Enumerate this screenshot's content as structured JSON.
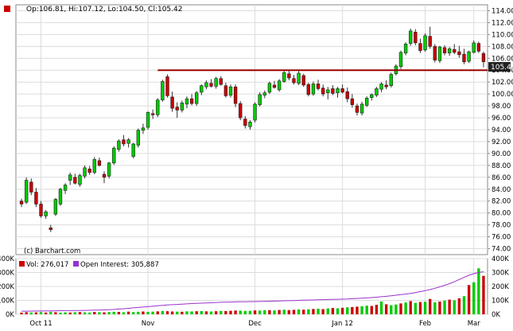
{
  "chart_data": [
    {
      "type": "candlestick",
      "legend": {
        "label": "Op:106.81, Hi:107.12, Lo:104.50, Cl:105.42"
      },
      "open": 106.81,
      "high": 107.12,
      "low": 104.5,
      "close": 105.42,
      "last_price_label": "105.42",
      "watermark": "(c) Barchart.com",
      "y_ticks": [
        "114.00",
        "112.00",
        "110.00",
        "108.00",
        "106.00",
        "104.00",
        "102.00",
        "100.00",
        "98.00",
        "96.00",
        "94.00",
        "92.00",
        "90.00",
        "88.00",
        "86.00",
        "84.00",
        "82.00",
        "80.00",
        "78.00",
        "76.00",
        "74.00"
      ],
      "ylim": [
        73,
        115
      ],
      "support_line": 104.0,
      "x_tick_labels": [
        "Oct 11",
        "Nov",
        "Dec",
        "Jan 12",
        "Feb",
        "Mar"
      ],
      "grid": true,
      "candles": [
        [
          82.0,
          82.4,
          81.0,
          81.5
        ],
        [
          81.8,
          86.0,
          81.5,
          85.5
        ],
        [
          85.2,
          85.8,
          83.0,
          83.5
        ],
        [
          83.5,
          84.2,
          81.0,
          81.5
        ],
        [
          81.5,
          82.0,
          79.2,
          79.5
        ],
        [
          79.5,
          80.5,
          79.0,
          80.2
        ],
        [
          77.5,
          78.0,
          76.8,
          77.2
        ],
        [
          79.8,
          82.5,
          79.5,
          82.3
        ],
        [
          81.5,
          84.2,
          81.2,
          84.0
        ],
        [
          83.8,
          85.0,
          83.2,
          84.7
        ],
        [
          85.5,
          86.8,
          84.7,
          86.4
        ],
        [
          86.0,
          86.6,
          84.8,
          85.0
        ],
        [
          84.8,
          86.6,
          84.4,
          86.3
        ],
        [
          86.2,
          88.0,
          85.8,
          87.6
        ],
        [
          87.4,
          87.9,
          86.4,
          86.8
        ],
        [
          86.8,
          89.4,
          86.5,
          89.0
        ],
        [
          88.8,
          89.3,
          87.8,
          88.0
        ],
        [
          86.5,
          87.0,
          85.0,
          86.0
        ],
        [
          86.2,
          88.6,
          85.8,
          88.4
        ],
        [
          88.4,
          91.2,
          88.1,
          90.9
        ],
        [
          90.7,
          92.4,
          90.3,
          92.1
        ],
        [
          92.3,
          93.1,
          91.2,
          91.6
        ],
        [
          91.7,
          92.6,
          91.0,
          92.3
        ],
        [
          89.5,
          91.8,
          89.2,
          91.6
        ],
        [
          91.4,
          94.2,
          91.0,
          93.9
        ],
        [
          93.9,
          95.0,
          93.3,
          94.3
        ],
        [
          94.4,
          97.1,
          94.0,
          96.9
        ],
        [
          96.7,
          97.4,
          95.8,
          96.5
        ],
        [
          96.5,
          99.3,
          96.1,
          99.0
        ],
        [
          99.0,
          102.4,
          98.7,
          102.1
        ],
        [
          102.9,
          103.3,
          99.4,
          99.7
        ],
        [
          99.5,
          100.4,
          97.0,
          97.6
        ],
        [
          97.8,
          98.6,
          96.0,
          97.3
        ],
        [
          97.3,
          98.9,
          96.9,
          98.5
        ],
        [
          98.3,
          99.6,
          97.6,
          99.2
        ],
        [
          99.2,
          100.0,
          98.1,
          98.4
        ],
        [
          98.4,
          100.5,
          98.0,
          100.2
        ],
        [
          100.3,
          101.6,
          99.8,
          101.4
        ],
        [
          101.2,
          102.3,
          100.8,
          101.9
        ],
        [
          101.8,
          102.5,
          101.1,
          101.3
        ],
        [
          101.3,
          102.9,
          100.9,
          102.6
        ],
        [
          102.6,
          103.0,
          101.4,
          101.6
        ],
        [
          101.4,
          101.9,
          99.4,
          99.7
        ],
        [
          99.8,
          101.6,
          99.4,
          101.2
        ],
        [
          101.2,
          101.6,
          97.8,
          98.4
        ],
        [
          98.4,
          98.8,
          95.6,
          96.0
        ],
        [
          95.8,
          96.3,
          94.2,
          94.7
        ],
        [
          94.5,
          95.6,
          94.0,
          95.3
        ],
        [
          95.6,
          98.6,
          95.2,
          98.3
        ],
        [
          98.2,
          100.3,
          97.9,
          99.9
        ],
        [
          99.8,
          100.6,
          99.3,
          100.2
        ],
        [
          100.3,
          102.1,
          100.0,
          101.8
        ],
        [
          101.5,
          102.2,
          100.9,
          101.1
        ],
        [
          100.7,
          102.5,
          100.4,
          102.2
        ],
        [
          102.1,
          103.9,
          101.9,
          103.6
        ],
        [
          103.4,
          104.0,
          102.3,
          102.7
        ],
        [
          102.6,
          103.2,
          101.6,
          101.9
        ],
        [
          101.8,
          103.9,
          101.5,
          103.5
        ],
        [
          103.1,
          103.4,
          101.2,
          101.5
        ],
        [
          101.6,
          101.9,
          99.6,
          99.9
        ],
        [
          100.0,
          102.1,
          99.7,
          101.7
        ],
        [
          101.7,
          102.4,
          100.6,
          100.9
        ],
        [
          101.0,
          101.6,
          99.6,
          100.0
        ],
        [
          100.2,
          101.2,
          99.1,
          100.7
        ],
        [
          100.9,
          101.5,
          99.8,
          100.1
        ],
        [
          100.2,
          101.2,
          99.4,
          100.9
        ],
        [
          100.9,
          101.6,
          100.1,
          100.3
        ],
        [
          100.4,
          101.1,
          98.6,
          99.2
        ],
        [
          99.2,
          100.0,
          97.7,
          98.2
        ],
        [
          98.0,
          98.4,
          96.4,
          96.9
        ],
        [
          96.8,
          98.7,
          96.4,
          98.3
        ],
        [
          98.1,
          99.6,
          97.8,
          99.3
        ],
        [
          99.4,
          100.1,
          98.9,
          99.9
        ],
        [
          99.8,
          101.2,
          99.5,
          100.9
        ],
        [
          100.8,
          102.0,
          100.3,
          101.7
        ],
        [
          101.5,
          102.3,
          100.8,
          101.2
        ],
        [
          101.4,
          103.6,
          101.1,
          103.3
        ],
        [
          103.4,
          105.0,
          103.1,
          104.7
        ],
        [
          104.6,
          107.3,
          104.2,
          107.0
        ],
        [
          106.9,
          108.7,
          106.5,
          108.4
        ],
        [
          108.5,
          111.0,
          108.1,
          110.6
        ],
        [
          110.4,
          110.9,
          108.2,
          108.6
        ],
        [
          108.5,
          109.3,
          106.9,
          107.3
        ],
        [
          107.4,
          110.2,
          107.1,
          109.8
        ],
        [
          109.7,
          111.3,
          107.6,
          108.0
        ],
        [
          108.0,
          108.4,
          105.3,
          105.7
        ],
        [
          105.6,
          108.1,
          105.2,
          107.9
        ],
        [
          107.8,
          108.2,
          106.5,
          106.9
        ],
        [
          106.9,
          107.9,
          106.4,
          107.6
        ],
        [
          107.5,
          108.4,
          106.7,
          107.0
        ],
        [
          107.1,
          108.1,
          106.1,
          106.6
        ],
        [
          106.7,
          107.6,
          105.0,
          105.4
        ],
        [
          105.5,
          107.3,
          105.2,
          107.1
        ],
        [
          107.0,
          109.0,
          106.8,
          108.6
        ],
        [
          108.5,
          108.8,
          106.9,
          107.2
        ],
        [
          106.81,
          107.12,
          104.5,
          105.42
        ]
      ]
    },
    {
      "type": "bar+line",
      "legend": {
        "vol_label": "Vol: 276,017",
        "oi_label": "Open Interest: 305,887"
      },
      "y_ticks": [
        "400K",
        "300K",
        "200K",
        "100K",
        "0K"
      ],
      "ylim": [
        0,
        400000
      ],
      "volume": [
        12000,
        15000,
        13000,
        14000,
        16000,
        13000,
        18000,
        15000,
        12000,
        14000,
        13000,
        15000,
        16000,
        14000,
        13000,
        17000,
        15000,
        14000,
        16000,
        18000,
        17000,
        15000,
        19000,
        16000,
        18000,
        20000,
        17000,
        19000,
        21000,
        24000,
        22000,
        20000,
        19000,
        18000,
        21000,
        20000,
        22000,
        23000,
        21000,
        20000,
        22000,
        24000,
        23000,
        25000,
        27000,
        26000,
        24000,
        25000,
        28000,
        27000,
        29000,
        30000,
        28000,
        31000,
        33000,
        30000,
        32000,
        35000,
        33000,
        36000,
        38000,
        40000,
        37000,
        42000,
        45000,
        43000,
        47000,
        50000,
        52000,
        55000,
        58000,
        62000,
        60000,
        68000,
        92000,
        72000,
        65000,
        70000,
        78000,
        85000,
        95000,
        82000,
        88000,
        90000,
        110000,
        86000,
        92000,
        98000,
        105000,
        100000,
        115000,
        130000,
        210000,
        230000,
        330000,
        276017
      ],
      "volume_colors": [
        "r",
        "r",
        "g",
        "r",
        "g",
        "r",
        "g",
        "r",
        "g",
        "g",
        "r",
        "g",
        "r",
        "g",
        "g",
        "r",
        "g",
        "r",
        "g",
        "g",
        "r",
        "g",
        "r",
        "g",
        "g",
        "r",
        "g",
        "g",
        "r",
        "g",
        "r",
        "r",
        "g",
        "r",
        "g",
        "g",
        "r",
        "g",
        "r",
        "g",
        "r",
        "g",
        "r",
        "r",
        "r",
        "g",
        "g",
        "g",
        "r",
        "g",
        "g",
        "r",
        "g",
        "r",
        "g",
        "r",
        "r",
        "g",
        "r",
        "g",
        "r",
        "g",
        "r",
        "g",
        "r",
        "g",
        "r",
        "g",
        "r",
        "r",
        "g",
        "g",
        "r",
        "r",
        "g",
        "r",
        "g",
        "g",
        "r",
        "g",
        "r",
        "g",
        "r",
        "g",
        "r",
        "g",
        "r",
        "g",
        "r",
        "g",
        "r",
        "g",
        "r",
        "g",
        "g",
        "r"
      ],
      "open_interest": [
        22000,
        22500,
        23000,
        23300,
        23700,
        24000,
        24500,
        25000,
        25500,
        26000,
        26500,
        27000,
        27500,
        28000,
        28800,
        29500,
        30500,
        31500,
        33000,
        35000,
        37500,
        40000,
        43000,
        46000,
        49000,
        52000,
        55000,
        58000,
        61000,
        64000,
        67000,
        69000,
        71000,
        73000,
        75000,
        77000,
        78500,
        80000,
        81500,
        83000,
        84500,
        86000,
        87000,
        88000,
        89000,
        90000,
        90500,
        91000,
        91500,
        92000,
        93000,
        94000,
        95000,
        96000,
        97000,
        98000,
        99000,
        100000,
        101000,
        102000,
        103000,
        104000,
        105000,
        106000,
        107000,
        108000,
        109000,
        110000,
        112000,
        114000,
        116000,
        118000,
        120000,
        123000,
        126000,
        129000,
        133000,
        137000,
        141000,
        145000,
        150000,
        156000,
        163000,
        170000,
        178000,
        187000,
        197000,
        208000,
        220000,
        234000,
        250000,
        265000,
        280000,
        292000,
        300000,
        305887
      ]
    }
  ],
  "colors": {
    "up": "#00cc00",
    "down": "#cc0000",
    "support_line": "#990000",
    "open_interest_line": "#9933cc",
    "grid": "#dcdcdc",
    "frame": "#888888"
  }
}
